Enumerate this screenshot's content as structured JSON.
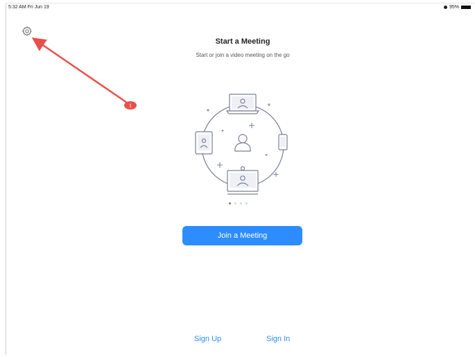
{
  "status_bar": {
    "time": "5:32 AM  Fri Jun 19",
    "battery": "95%"
  },
  "settings": {
    "icon": "gear-icon"
  },
  "home": {
    "title": "Start a Meeting",
    "subtitle": "Start or join a video meeting on the go"
  },
  "carousel": {
    "page_count": 4,
    "active_index": 0
  },
  "actions": {
    "join_label": "Join a Meeting",
    "sign_up_label": "Sign Up",
    "sign_in_label": "Sign In"
  },
  "annotation": {
    "badge_label": "1",
    "color": "#e8504a"
  },
  "colors": {
    "accent": "#2d8cff",
    "illustration_stroke": "#7a7f93"
  }
}
